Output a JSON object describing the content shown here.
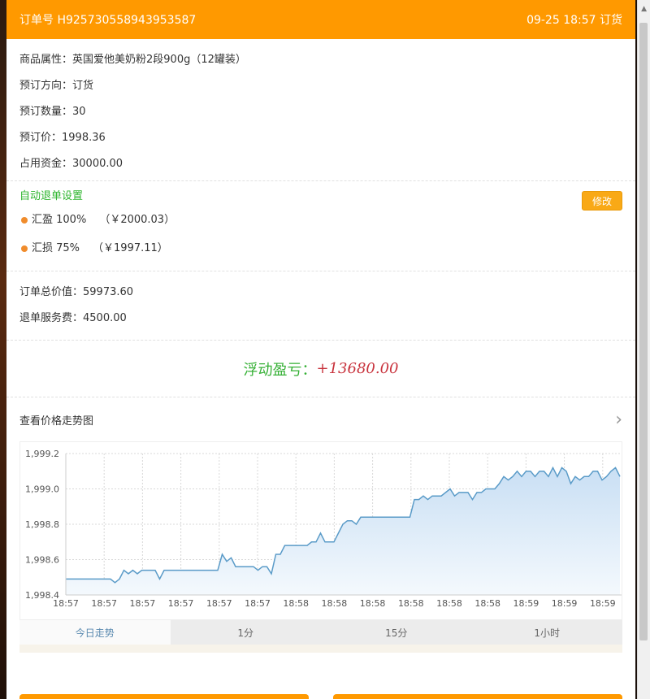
{
  "header": {
    "order_no": "订单号 H925730558943953587",
    "time_dir": "09-25 18:57 订货"
  },
  "info": {
    "product": "商品属性：英国爱他美奶粉2段900g（12罐装）",
    "direction": "预订方向：订货",
    "quantity": "预订数量：30",
    "price": "预订价：1998.36",
    "capital": "占用资金：30000.00"
  },
  "auto_close": {
    "title": "自动退单设置",
    "edit_label": "修改",
    "profit_label": "汇盈 100%",
    "profit_value": "（￥2000.03）",
    "loss_label": "汇损 75%",
    "loss_value": "（￥1997.11）"
  },
  "totals": {
    "order_value": "订单总价值：59973.60",
    "service_fee": "退单服务费：4500.00"
  },
  "pnl": {
    "label": "浮动盈亏：",
    "value": "+13680.00"
  },
  "trend": {
    "link_label": "查看价格走势图"
  },
  "chart_data": {
    "type": "area",
    "y_ticks": [
      "1,999.2",
      "1,999.0",
      "1,998.8",
      "1,998.6",
      "1,998.4"
    ],
    "ylim": [
      1998.4,
      1999.2
    ],
    "x_ticks": [
      "18:57",
      "18:57",
      "18:57",
      "18:57",
      "18:57",
      "18:57",
      "18:58",
      "18:58",
      "18:58",
      "18:58",
      "18:58",
      "18:58",
      "18:59",
      "18:59",
      "18:59"
    ],
    "values": [
      1998.49,
      1998.49,
      1998.49,
      1998.49,
      1998.49,
      1998.49,
      1998.49,
      1998.49,
      1998.49,
      1998.49,
      1998.49,
      1998.47,
      1998.49,
      1998.54,
      1998.52,
      1998.54,
      1998.52,
      1998.54,
      1998.54,
      1998.54,
      1998.54,
      1998.49,
      1998.54,
      1998.54,
      1998.54,
      1998.54,
      1998.54,
      1998.54,
      1998.54,
      1998.54,
      1998.54,
      1998.54,
      1998.54,
      1998.54,
      1998.54,
      1998.63,
      1998.59,
      1998.61,
      1998.56,
      1998.56,
      1998.56,
      1998.56,
      1998.56,
      1998.54,
      1998.56,
      1998.56,
      1998.52,
      1998.63,
      1998.63,
      1998.68,
      1998.68,
      1998.68,
      1998.68,
      1998.68,
      1998.68,
      1998.7,
      1998.7,
      1998.75,
      1998.7,
      1998.7,
      1998.7,
      1998.75,
      1998.8,
      1998.82,
      1998.82,
      1998.8,
      1998.84,
      1998.84,
      1998.84,
      1998.84,
      1998.84,
      1998.84,
      1998.84,
      1998.84,
      1998.84,
      1998.84,
      1998.84,
      1998.84,
      1998.94,
      1998.94,
      1998.96,
      1998.94,
      1998.96,
      1998.96,
      1998.96,
      1998.98,
      1999.0,
      1998.96,
      1998.98,
      1998.98,
      1998.98,
      1998.94,
      1998.98,
      1998.98,
      1999.0,
      1999.0,
      1999.0,
      1999.03,
      1999.07,
      1999.05,
      1999.07,
      1999.1,
      1999.07,
      1999.1,
      1999.1,
      1999.07,
      1999.1,
      1999.1,
      1999.07,
      1999.12,
      1999.07,
      1999.12,
      1999.1,
      1999.03,
      1999.07,
      1999.05,
      1999.07,
      1999.07,
      1999.1,
      1999.1,
      1999.05,
      1999.07,
      1999.1,
      1999.12,
      1999.07
    ],
    "colors": {
      "line": "#5a9bc8",
      "fill_top": "#c9dff4",
      "fill_bottom": "#f4f9fd",
      "grid": "#d8d8d8"
    }
  },
  "tabs": [
    "今日走势",
    "1分",
    "15分",
    "1小时"
  ]
}
